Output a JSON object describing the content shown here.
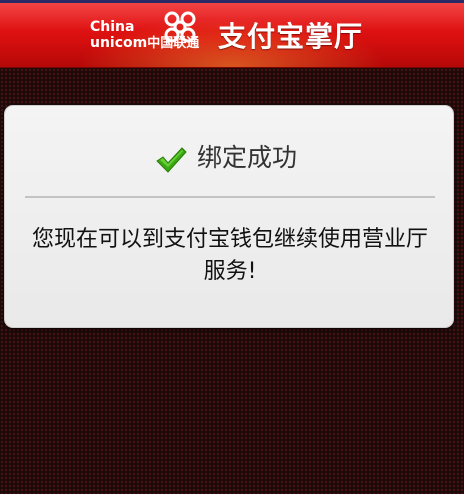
{
  "header": {
    "brand_en_line1": "China",
    "brand_en_line2": "unicom",
    "brand_cn": "中国联通",
    "logo_icon": "unicom-knot-icon",
    "app_title": "支付宝掌厅"
  },
  "dialog": {
    "status_icon": "check-icon",
    "title": "绑定成功",
    "message": "您现在可以到支付宝钱包继续使用营业厅服务!"
  },
  "colors": {
    "header_red": "#d90f0f",
    "check_green": "#3aa810",
    "dialog_bg": "#f0f0f0",
    "page_bg": "#1c0a0a"
  }
}
